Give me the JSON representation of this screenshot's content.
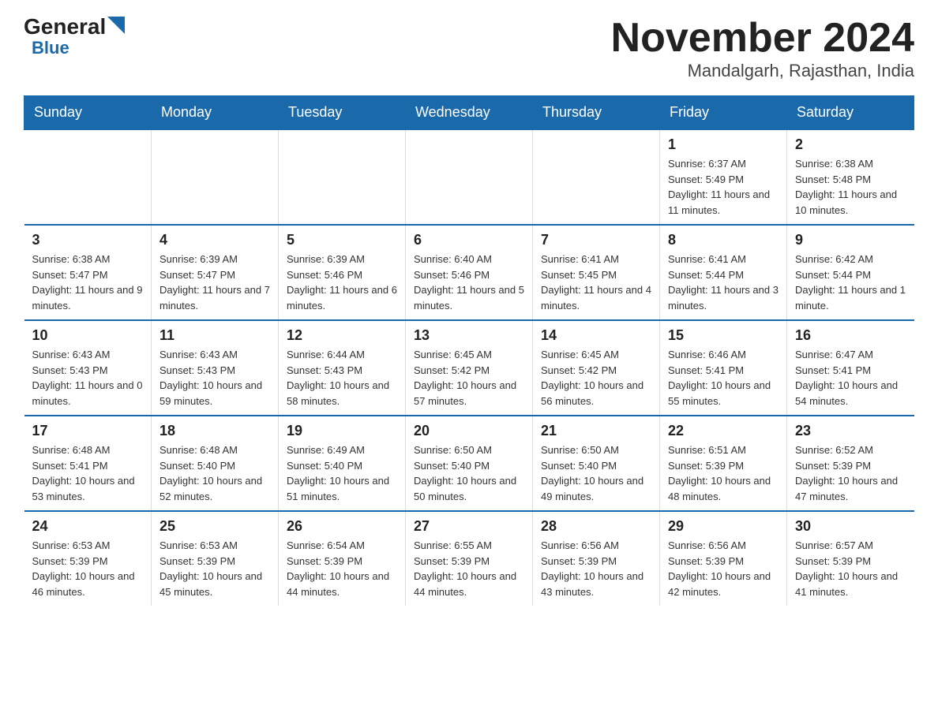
{
  "header": {
    "logo_general": "General",
    "logo_blue": "Blue",
    "title": "November 2024",
    "subtitle": "Mandalgarh, Rajasthan, India"
  },
  "days_of_week": [
    "Sunday",
    "Monday",
    "Tuesday",
    "Wednesday",
    "Thursday",
    "Friday",
    "Saturday"
  ],
  "weeks": [
    [
      {
        "day": "",
        "info": ""
      },
      {
        "day": "",
        "info": ""
      },
      {
        "day": "",
        "info": ""
      },
      {
        "day": "",
        "info": ""
      },
      {
        "day": "",
        "info": ""
      },
      {
        "day": "1",
        "info": "Sunrise: 6:37 AM\nSunset: 5:49 PM\nDaylight: 11 hours and 11 minutes."
      },
      {
        "day": "2",
        "info": "Sunrise: 6:38 AM\nSunset: 5:48 PM\nDaylight: 11 hours and 10 minutes."
      }
    ],
    [
      {
        "day": "3",
        "info": "Sunrise: 6:38 AM\nSunset: 5:47 PM\nDaylight: 11 hours and 9 minutes."
      },
      {
        "day": "4",
        "info": "Sunrise: 6:39 AM\nSunset: 5:47 PM\nDaylight: 11 hours and 7 minutes."
      },
      {
        "day": "5",
        "info": "Sunrise: 6:39 AM\nSunset: 5:46 PM\nDaylight: 11 hours and 6 minutes."
      },
      {
        "day": "6",
        "info": "Sunrise: 6:40 AM\nSunset: 5:46 PM\nDaylight: 11 hours and 5 minutes."
      },
      {
        "day": "7",
        "info": "Sunrise: 6:41 AM\nSunset: 5:45 PM\nDaylight: 11 hours and 4 minutes."
      },
      {
        "day": "8",
        "info": "Sunrise: 6:41 AM\nSunset: 5:44 PM\nDaylight: 11 hours and 3 minutes."
      },
      {
        "day": "9",
        "info": "Sunrise: 6:42 AM\nSunset: 5:44 PM\nDaylight: 11 hours and 1 minute."
      }
    ],
    [
      {
        "day": "10",
        "info": "Sunrise: 6:43 AM\nSunset: 5:43 PM\nDaylight: 11 hours and 0 minutes."
      },
      {
        "day": "11",
        "info": "Sunrise: 6:43 AM\nSunset: 5:43 PM\nDaylight: 10 hours and 59 minutes."
      },
      {
        "day": "12",
        "info": "Sunrise: 6:44 AM\nSunset: 5:43 PM\nDaylight: 10 hours and 58 minutes."
      },
      {
        "day": "13",
        "info": "Sunrise: 6:45 AM\nSunset: 5:42 PM\nDaylight: 10 hours and 57 minutes."
      },
      {
        "day": "14",
        "info": "Sunrise: 6:45 AM\nSunset: 5:42 PM\nDaylight: 10 hours and 56 minutes."
      },
      {
        "day": "15",
        "info": "Sunrise: 6:46 AM\nSunset: 5:41 PM\nDaylight: 10 hours and 55 minutes."
      },
      {
        "day": "16",
        "info": "Sunrise: 6:47 AM\nSunset: 5:41 PM\nDaylight: 10 hours and 54 minutes."
      }
    ],
    [
      {
        "day": "17",
        "info": "Sunrise: 6:48 AM\nSunset: 5:41 PM\nDaylight: 10 hours and 53 minutes."
      },
      {
        "day": "18",
        "info": "Sunrise: 6:48 AM\nSunset: 5:40 PM\nDaylight: 10 hours and 52 minutes."
      },
      {
        "day": "19",
        "info": "Sunrise: 6:49 AM\nSunset: 5:40 PM\nDaylight: 10 hours and 51 minutes."
      },
      {
        "day": "20",
        "info": "Sunrise: 6:50 AM\nSunset: 5:40 PM\nDaylight: 10 hours and 50 minutes."
      },
      {
        "day": "21",
        "info": "Sunrise: 6:50 AM\nSunset: 5:40 PM\nDaylight: 10 hours and 49 minutes."
      },
      {
        "day": "22",
        "info": "Sunrise: 6:51 AM\nSunset: 5:39 PM\nDaylight: 10 hours and 48 minutes."
      },
      {
        "day": "23",
        "info": "Sunrise: 6:52 AM\nSunset: 5:39 PM\nDaylight: 10 hours and 47 minutes."
      }
    ],
    [
      {
        "day": "24",
        "info": "Sunrise: 6:53 AM\nSunset: 5:39 PM\nDaylight: 10 hours and 46 minutes."
      },
      {
        "day": "25",
        "info": "Sunrise: 6:53 AM\nSunset: 5:39 PM\nDaylight: 10 hours and 45 minutes."
      },
      {
        "day": "26",
        "info": "Sunrise: 6:54 AM\nSunset: 5:39 PM\nDaylight: 10 hours and 44 minutes."
      },
      {
        "day": "27",
        "info": "Sunrise: 6:55 AM\nSunset: 5:39 PM\nDaylight: 10 hours and 44 minutes."
      },
      {
        "day": "28",
        "info": "Sunrise: 6:56 AM\nSunset: 5:39 PM\nDaylight: 10 hours and 43 minutes."
      },
      {
        "day": "29",
        "info": "Sunrise: 6:56 AM\nSunset: 5:39 PM\nDaylight: 10 hours and 42 minutes."
      },
      {
        "day": "30",
        "info": "Sunrise: 6:57 AM\nSunset: 5:39 PM\nDaylight: 10 hours and 41 minutes."
      }
    ]
  ]
}
